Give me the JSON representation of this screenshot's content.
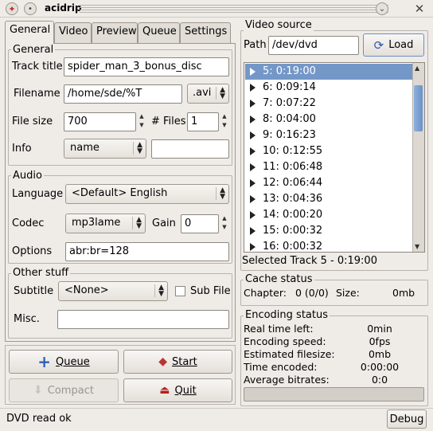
{
  "window": {
    "title": "acidrip"
  },
  "tabs": [
    "General",
    "Video",
    "Preview",
    "Queue",
    "Settings"
  ],
  "general": {
    "section": "General",
    "track_title_label": "Track title",
    "track_title_value": "spider_man_3_bonus_disc",
    "filename_label": "Filename",
    "filename_value": "/home/sde/%T",
    "ext_value": ".avi",
    "filesize_label": "File size",
    "filesize_value": "700",
    "files_label": "# Files",
    "files_value": "1",
    "info_label": "Info",
    "info_value": "name",
    "info_text": ""
  },
  "audio": {
    "section": "Audio",
    "language_label": "Language",
    "language_value": "<Default> English",
    "codec_label": "Codec",
    "codec_value": "mp3lame",
    "gain_label": "Gain",
    "gain_value": "0",
    "options_label": "Options",
    "options_value": "abr:br=128"
  },
  "other": {
    "section": "Other stuff",
    "subtitle_label": "Subtitle",
    "subtitle_value": "<None>",
    "subfile_label": "Sub File",
    "misc_label": "Misc.",
    "misc_value": ""
  },
  "buttons": {
    "queue": "Queue",
    "start": "Start",
    "compact": "Compact",
    "quit": "Quit",
    "load": "Load",
    "debug": "Debug"
  },
  "video_source": {
    "section": "Video source",
    "path_label": "Path",
    "path_value": "/dev/dvd",
    "tracks": [
      "5: 0:19:00",
      "6: 0:09:14",
      "7: 0:07:22",
      "8: 0:04:00",
      "9: 0:16:23",
      "10: 0:12:55",
      "11: 0:06:48",
      "12: 0:06:44",
      "13: 0:04:36",
      "14: 0:00:20",
      "15: 0:00:32",
      "16: 0:00:32"
    ],
    "selected_index": 0,
    "selected_text": "Selected Track 5 - 0:19:00"
  },
  "cache": {
    "section": "Cache status",
    "chapter_label": "Chapter:",
    "chapter_value": "0 (0/0)",
    "size_label": "Size:",
    "size_value": "0mb"
  },
  "encoding": {
    "section": "Encoding status",
    "rows": [
      {
        "label": "Real time left:",
        "value": "0min"
      },
      {
        "label": "Encoding speed:",
        "value": "0fps"
      },
      {
        "label": "Estimated filesize:",
        "value": "0mb"
      },
      {
        "label": "Time encoded:",
        "value": "0:00:00"
      },
      {
        "label": "Average bitrates:",
        "value": "0:0"
      }
    ],
    "progress": 0
  },
  "status": {
    "text": "DVD read ok"
  },
  "colors": {
    "selection": "#7497c8",
    "background": "#efebe7"
  }
}
